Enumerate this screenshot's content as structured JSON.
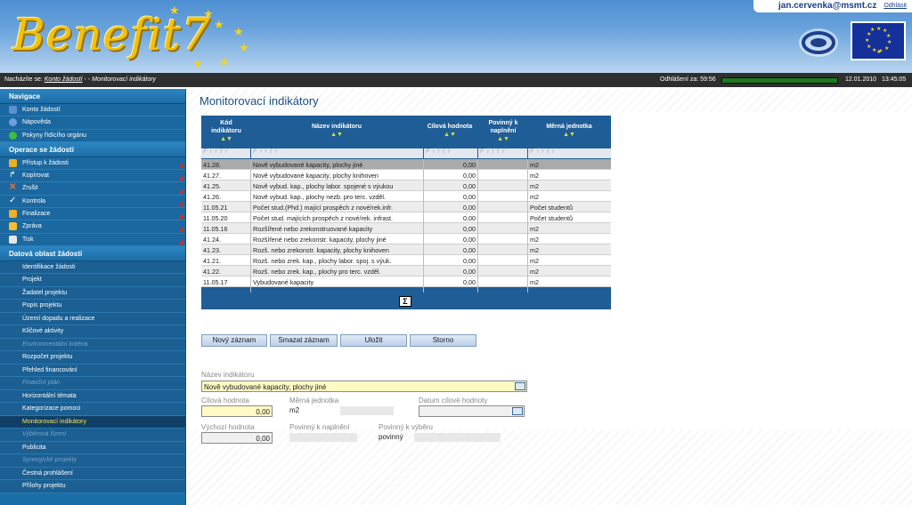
{
  "header": {
    "logo_text": "Benefit7",
    "user_email": "jan.cervenka@msmt.cz",
    "logout_link": "Odhlásit"
  },
  "crumbbar": {
    "label": "Nacházíte se:",
    "link": "Konto žádostí",
    "separator": " - - ",
    "current": "Monitorovací indikátory",
    "logout_timer_label": "Odhlášení za: 59:56",
    "date": "12.01.2010",
    "time": "13:45:05"
  },
  "sidebar": {
    "sections": [
      {
        "title": "Navigace",
        "items": [
          {
            "label": "Konto žádostí",
            "icon": "list-icon",
            "color": "#5a8fd6",
            "tri": false
          },
          {
            "label": "Nápověda",
            "icon": "help-icon",
            "color": "#6f9fe0",
            "tri": false
          },
          {
            "label": "Pokyny řídícího orgánu",
            "icon": "smiley-icon",
            "color": "#3bbf3b",
            "tri": false
          }
        ]
      },
      {
        "title": "Operace se žádostí",
        "items": [
          {
            "label": "Přístup k žádosti",
            "icon": "users-icon",
            "color": "#e8b020",
            "tri": true
          },
          {
            "label": "Kopírovat",
            "icon": "arrow-icon",
            "color": "#d8e8f8",
            "tri": true
          },
          {
            "label": "Zrušit",
            "icon": "cross-icon",
            "color": "#e04a1a",
            "tri": true
          },
          {
            "label": "Kontrola",
            "icon": "check-icon",
            "color": "#ffffff",
            "tri": true
          },
          {
            "label": "Finalizace",
            "icon": "lock-icon",
            "color": "#f0b02a",
            "tri": true
          },
          {
            "label": "Zpráva",
            "icon": "mail-icon",
            "color": "#f4c02c",
            "tri": true
          },
          {
            "label": "Tisk",
            "icon": "print-icon",
            "color": "#e8e8e8",
            "tri": true
          }
        ]
      },
      {
        "title": "Datová oblast žádosti",
        "subitems": [
          {
            "label": "Identifikace žádosti",
            "state": "normal"
          },
          {
            "label": "Projekt",
            "state": "normal"
          },
          {
            "label": "Žadatel projektu",
            "state": "normal"
          },
          {
            "label": "Popis projektu",
            "state": "normal"
          },
          {
            "label": "Území dopadu a realizace",
            "state": "normal"
          },
          {
            "label": "Klíčové aktivity",
            "state": "normal"
          },
          {
            "label": "Environmentální kritéria",
            "state": "disabled"
          },
          {
            "label": "Rozpočet projektu",
            "state": "normal"
          },
          {
            "label": "Přehled financování",
            "state": "normal"
          },
          {
            "label": "Finanční plán",
            "state": "disabled"
          },
          {
            "label": "Horizontální témata",
            "state": "normal"
          },
          {
            "label": "Kategorizace pomoci",
            "state": "normal"
          },
          {
            "label": "Monitorovací indikátory",
            "state": "active"
          },
          {
            "label": "Výběrová řízení",
            "state": "disabled"
          },
          {
            "label": "Publicita",
            "state": "normal"
          },
          {
            "label": "Synergické projekty",
            "state": "disabled"
          },
          {
            "label": "Čestná prohlášení",
            "state": "normal"
          },
          {
            "label": "Přílohy projektu",
            "state": "normal"
          }
        ]
      }
    ]
  },
  "main": {
    "title": "Monitorovací indikátory",
    "table": {
      "columns": [
        {
          "line1": "Kód",
          "line2": "indikátoru"
        },
        {
          "line1": "Název indikátoru",
          "line2": ""
        },
        {
          "line1": "Cílová hodnota",
          "line2": ""
        },
        {
          "line1": "Povinný k",
          "line2": "naplnění"
        },
        {
          "line1": "Měrná jednotka",
          "line2": ""
        }
      ],
      "filter_placeholder": "F i l t r",
      "rows": [
        {
          "code": "41.28.",
          "name": "Nově vybudované kapacity, plochy jiné",
          "target": "0,00",
          "required": "",
          "unit": "m2",
          "selected": true
        },
        {
          "code": "41.27.",
          "name": "Nově vybudované kapacity, plochy knihoven",
          "target": "0,00",
          "required": "",
          "unit": "m2"
        },
        {
          "code": "41.25.",
          "name": "Nově vybud. kap., plochy labor. spojené s výukou",
          "target": "0,00",
          "required": "",
          "unit": "m2"
        },
        {
          "code": "41.26.",
          "name": "Nově vybud. kap., plochy nezb. pro terc. vzděl.",
          "target": "0,00",
          "required": "",
          "unit": "m2"
        },
        {
          "code": "11.05.21",
          "name": "Počet stud.(Phd.) mající prospěch z nové/rek.infr.",
          "target": "0,00",
          "required": "",
          "unit": "Počet studentů"
        },
        {
          "code": "11.05.20",
          "name": "Počet stud. majících prospěch z nové/rek. infrast.",
          "target": "0,00",
          "required": "",
          "unit": "Počet studentů"
        },
        {
          "code": "11.05.16",
          "name": "Rozšířené nebo zrekonstruované kapacity",
          "target": "0,00",
          "required": "",
          "unit": "m2"
        },
        {
          "code": "41.24.",
          "name": "Rozšířené nebo zrekonstr. kapacity, plochy jiné",
          "target": "0,00",
          "required": "",
          "unit": "m2"
        },
        {
          "code": "41.23.",
          "name": "Rozš. nebo zrekonstr. kapacity, plochy knihoven",
          "target": "0,00",
          "required": "",
          "unit": "m2"
        },
        {
          "code": "41.21.",
          "name": "Rozš. nebo zrek. kap., plochy labor. spoj. s výuk.",
          "target": "0,00",
          "required": "",
          "unit": "m2"
        },
        {
          "code": "41.22.",
          "name": "Rozš. nebo zrek. kap., plochy pro terc. vzděl.",
          "target": "0,00",
          "required": "",
          "unit": "m2"
        },
        {
          "code": "11.05.17",
          "name": "Vybudované kapacity",
          "target": "0,00",
          "required": "",
          "unit": "m2"
        }
      ],
      "sum_symbol": "Σ"
    },
    "buttons": {
      "new": "Nový záznam",
      "delete": "Smazat záznam",
      "save": "Uložit",
      "cancel": "Storno"
    },
    "form": {
      "indicator_name_label": "Název indikátoru",
      "indicator_name_value": "Nově vybudované kapacity, plochy jiné",
      "target_label": "Cílová hodnota",
      "target_value": "0,00",
      "unit_label": "Měrná jednotka",
      "unit_value": "m2",
      "target_date_label": "Datum cílové hodnoty",
      "target_date_value": "",
      "start_label": "Výchozí hodnota",
      "start_value": "0,00",
      "required_fill_label": "Povinný k naplnění",
      "required_fill_value": "",
      "required_select_label": "Povinný k výběru",
      "required_select_value": "povinný"
    }
  }
}
